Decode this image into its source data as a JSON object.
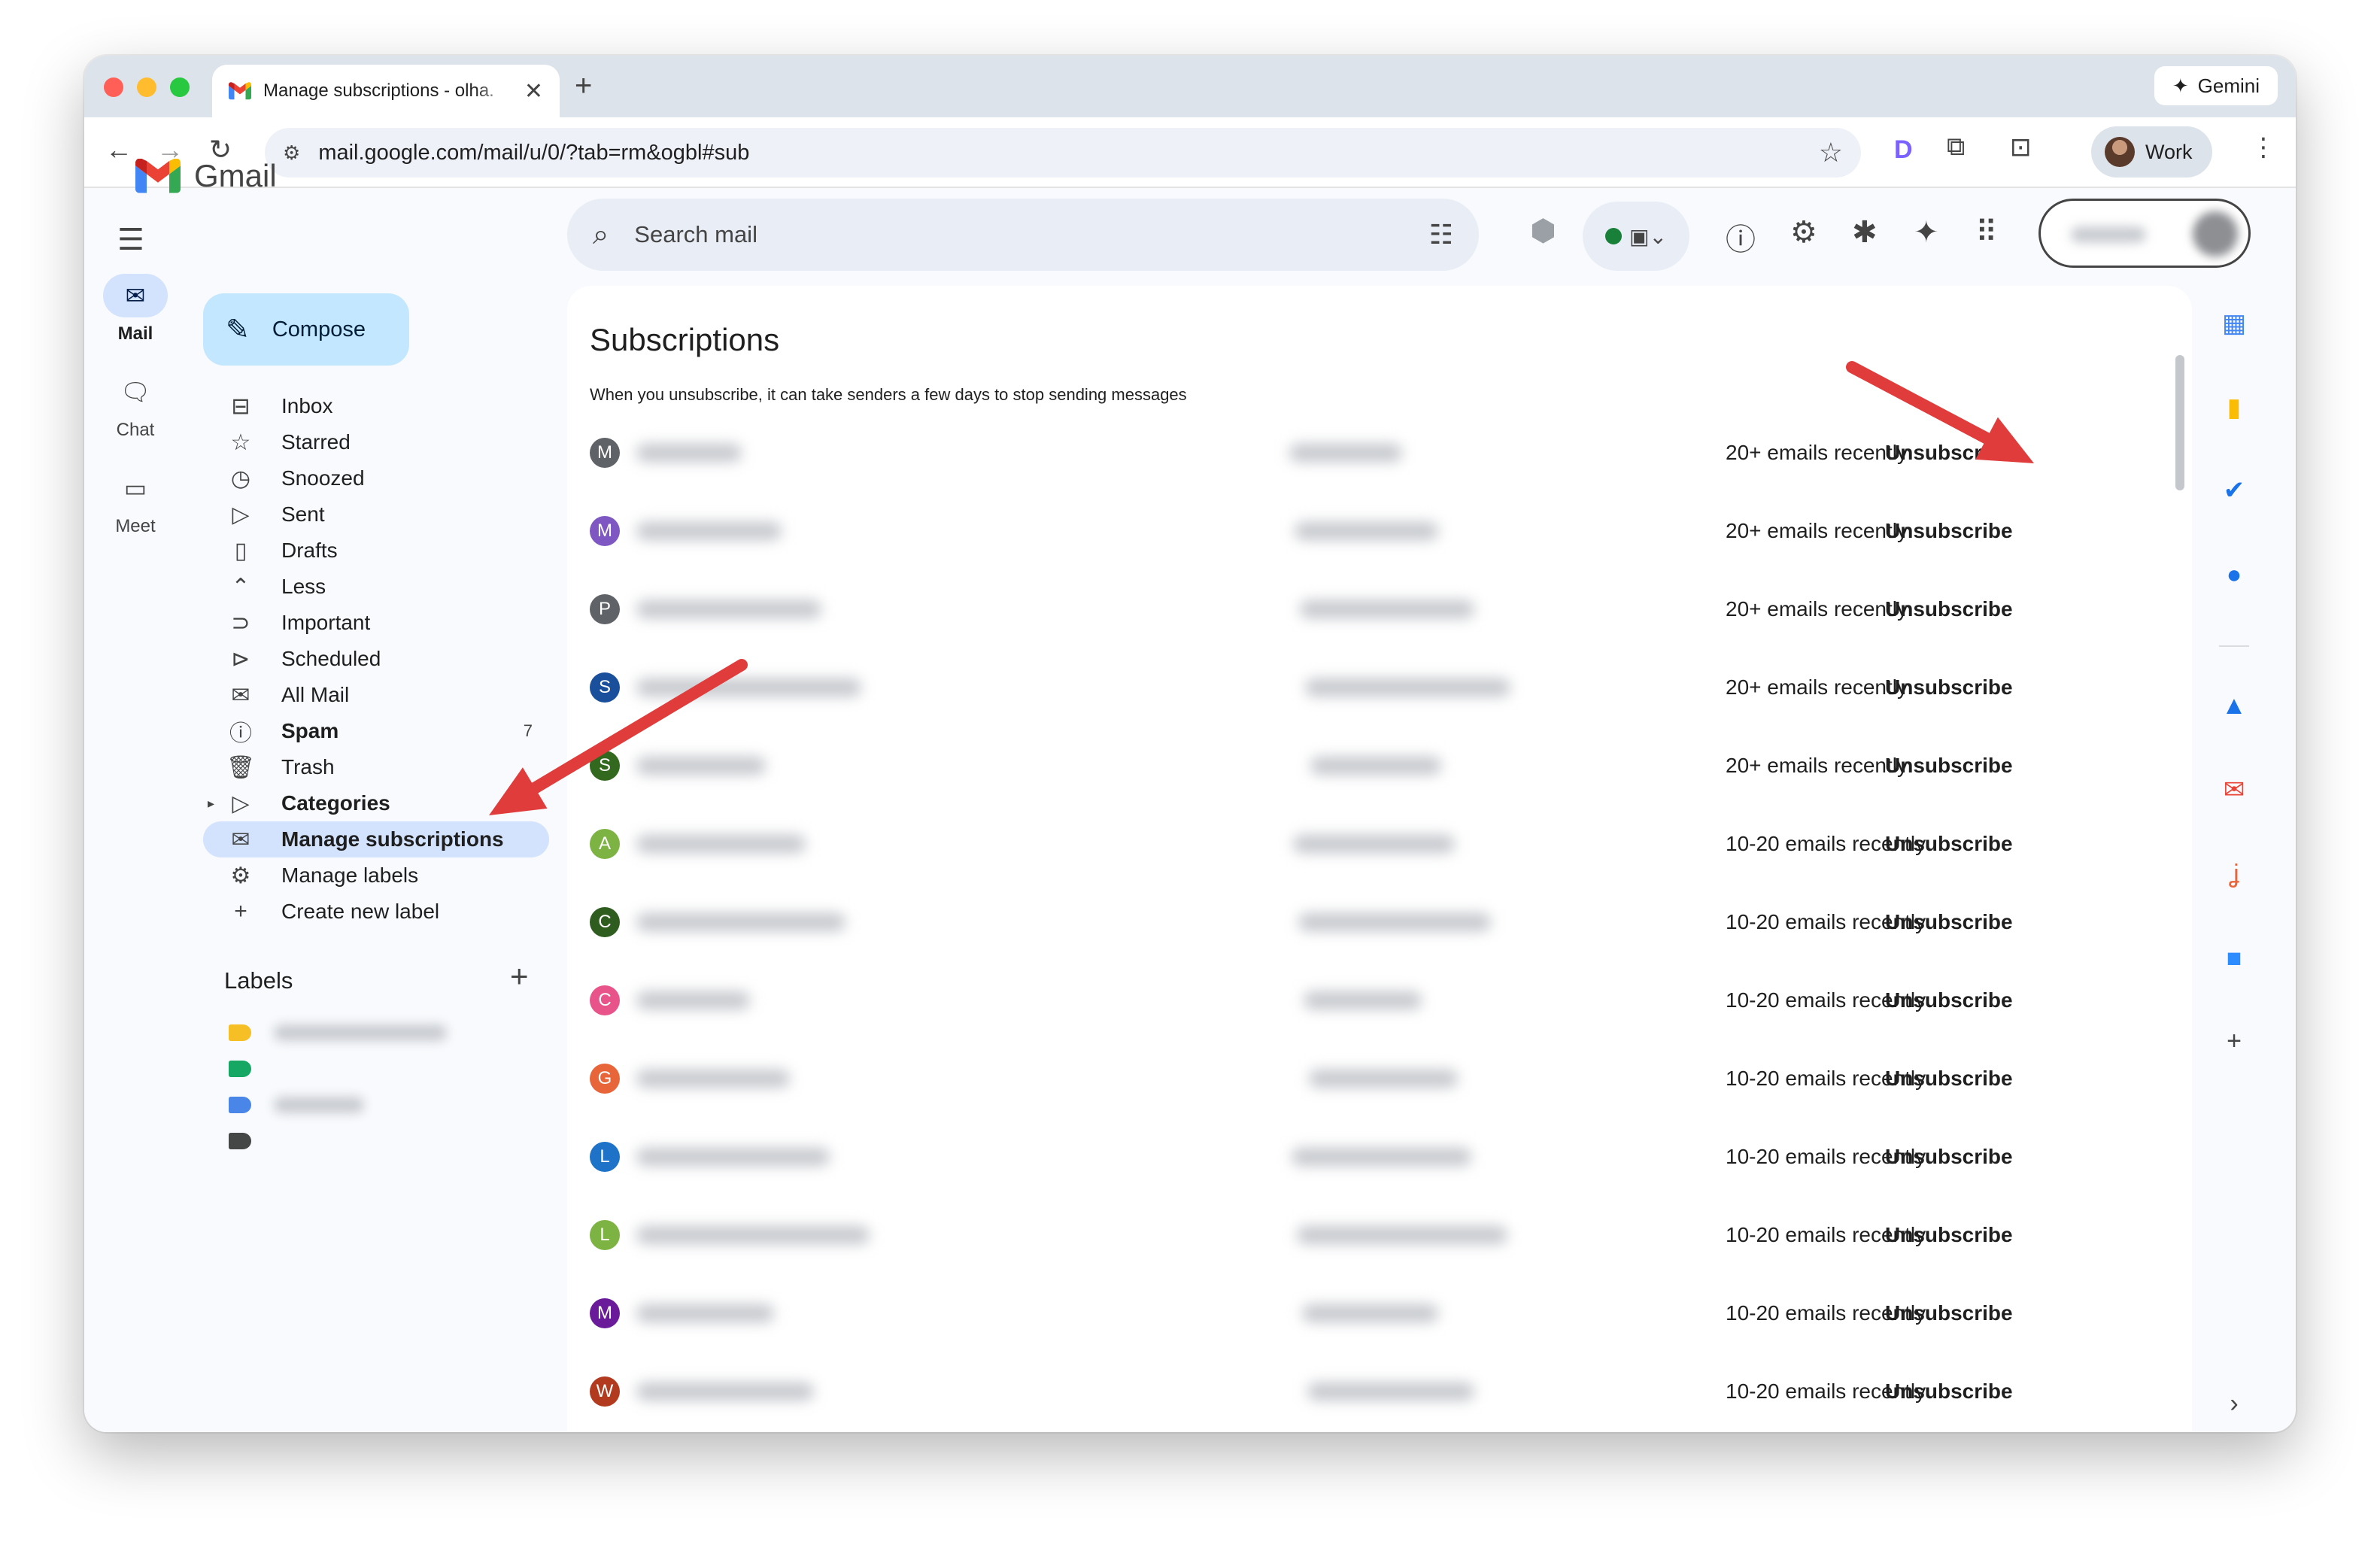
{
  "browser": {
    "tab_title": "Manage subscriptions - olha.",
    "url": "mail.google.com/mail/u/0/?tab=rm&ogbl#sub",
    "gemini_label": "Gemini",
    "profile_label": "Work"
  },
  "app": {
    "logo_text": "Gmail",
    "compose_label": "Compose",
    "search_placeholder": "Search mail"
  },
  "rail": [
    {
      "label": "Mail",
      "icon": "mail-icon",
      "active": true
    },
    {
      "label": "Chat",
      "icon": "chat-icon",
      "active": false
    },
    {
      "label": "Meet",
      "icon": "video-icon",
      "active": false
    }
  ],
  "nav": [
    {
      "label": "Inbox",
      "icon": "inbox-icon"
    },
    {
      "label": "Starred",
      "icon": "star-icon"
    },
    {
      "label": "Snoozed",
      "icon": "clock-icon"
    },
    {
      "label": "Sent",
      "icon": "send-icon"
    },
    {
      "label": "Drafts",
      "icon": "draft-icon"
    },
    {
      "label": "Less",
      "icon": "chevron-up-icon"
    },
    {
      "label": "Important",
      "icon": "important-icon"
    },
    {
      "label": "Scheduled",
      "icon": "scheduled-icon"
    },
    {
      "label": "All Mail",
      "icon": "all-mail-icon"
    },
    {
      "label": "Spam",
      "icon": "spam-icon",
      "bold": true,
      "count": "7"
    },
    {
      "label": "Trash",
      "icon": "trash-icon"
    },
    {
      "label": "Categories",
      "icon": "label-icon",
      "bold": true
    },
    {
      "label": "Manage subscriptions",
      "icon": "subscriptions-icon",
      "bold": true,
      "active": true
    },
    {
      "label": "Manage labels",
      "icon": "gear-icon"
    },
    {
      "label": "Create new label",
      "icon": "plus-icon"
    }
  ],
  "labels_section": {
    "title": "Labels",
    "colors": [
      "#f6bf26",
      "#16a765",
      "#4a86e8",
      "#444746"
    ]
  },
  "subscriptions": {
    "title": "Subscriptions",
    "subtitle": "When you unsubscribe, it can take senders a few days to stop sending messages",
    "rows": [
      {
        "initial": "M",
        "color": "#5f6368",
        "frequency": "20+ emails recently",
        "action": "Unsubscribe"
      },
      {
        "initial": "M",
        "color": "#7e57c2",
        "frequency": "20+ emails recently",
        "action": "Unsubscribe"
      },
      {
        "initial": "P",
        "color": "#5f6368",
        "frequency": "20+ emails recently",
        "action": "Unsubscribe"
      },
      {
        "initial": "S",
        "color": "#1a4f9c",
        "frequency": "20+ emails recently",
        "action": "Unsubscribe"
      },
      {
        "initial": "S",
        "color": "#33691e",
        "frequency": "20+ emails recently",
        "action": "Unsubscribe"
      },
      {
        "initial": "A",
        "color": "#7cb342",
        "frequency": "10-20 emails recently",
        "action": "Unsubscribe"
      },
      {
        "initial": "C",
        "color": "#2e5d1f",
        "frequency": "10-20 emails recently",
        "action": "Unsubscribe"
      },
      {
        "initial": "C",
        "color": "#e8548a",
        "frequency": "10-20 emails recently",
        "action": "Unsubscribe"
      },
      {
        "initial": "G",
        "color": "#e8653a",
        "frequency": "10-20 emails recently",
        "action": "Unsubscribe"
      },
      {
        "initial": "L",
        "color": "#1e73c9",
        "frequency": "10-20 emails recently",
        "action": "Unsubscribe"
      },
      {
        "initial": "L",
        "color": "#7cb342",
        "frequency": "10-20 emails recently",
        "action": "Unsubscribe"
      },
      {
        "initial": "M",
        "color": "#6a1b9a",
        "frequency": "10-20 emails recently",
        "action": "Unsubscribe"
      },
      {
        "initial": "W",
        "color": "#b23a1e",
        "frequency": "10-20 emails recently",
        "action": "Unsubscribe"
      }
    ]
  },
  "side_panel_icons": [
    "calendar-icon",
    "keep-icon",
    "tasks-icon",
    "contacts-icon",
    "ads-icon",
    "mail-app-icon",
    "hook-icon",
    "zoom-icon",
    "add-icon"
  ],
  "annotation_color": "#e03c3c"
}
